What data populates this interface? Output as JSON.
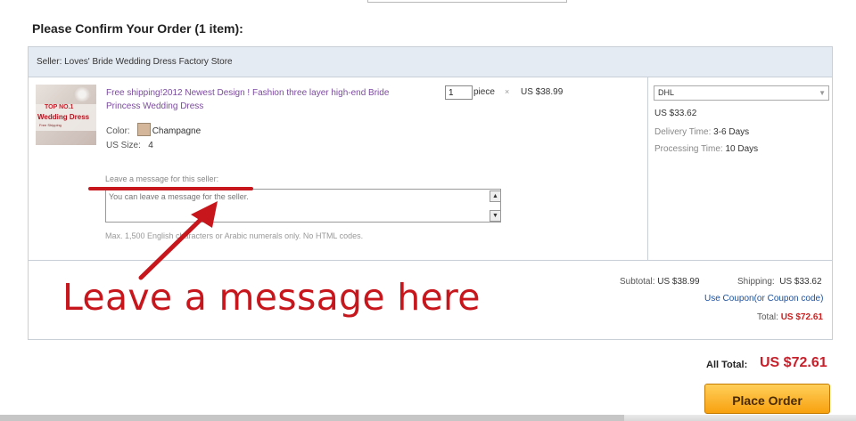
{
  "order": {
    "heading": "Please Confirm Your Order (1 item):",
    "seller": "Seller: Loves' Bride Wedding Dress Factory Store"
  },
  "item": {
    "thumbnail_text": {
      "line1": "TOP NO.1",
      "line2": "Wedding Dress",
      "line3": "Free Shipping"
    },
    "title": "Free shipping!2012 Newest Design ! Fashion three layer high-end Bride Princess Wedding Dress",
    "color_label": "Color:",
    "color_value": "Champagne",
    "color_swatch": "#d4b79a",
    "size_label": "US Size:",
    "size_value": "4",
    "quantity": "1",
    "quantity_unit": "piece",
    "times_symbol": "×",
    "unit_price": "US $38.99"
  },
  "message": {
    "label": "Leave a message for this seller:",
    "placeholder": "You can leave a message for the seller.",
    "hint": "Max. 1,500 English characters or Arabic numerals only. No HTML codes."
  },
  "shipping": {
    "method": "DHL",
    "cost": "US $33.62",
    "delivery_label": "Delivery Time:",
    "delivery_value": "3-6 Days",
    "processing_label": "Processing Time:",
    "processing_value": "10 Days"
  },
  "summary": {
    "subtotal_label": "Subtotal:",
    "subtotal_value": "US $38.99",
    "shipping_label": "Shipping:",
    "shipping_value": "US $33.62",
    "coupon_link": "Use Coupon(or Coupon code)",
    "total_label": "Total:",
    "total_value": "US $72.61"
  },
  "all_total": {
    "label": "All Total:",
    "value": "US $72.61"
  },
  "place_order_label": "Place Order",
  "annotation": {
    "text": "Leave a message here",
    "color": "#c8161d"
  },
  "colors": {
    "accent_red": "#c81f2a",
    "link_blue": "#1a4f9c",
    "title_purple": "#7b4b9e",
    "seller_bar": "#e5ebf3",
    "button_orange": "#f8a10f"
  }
}
